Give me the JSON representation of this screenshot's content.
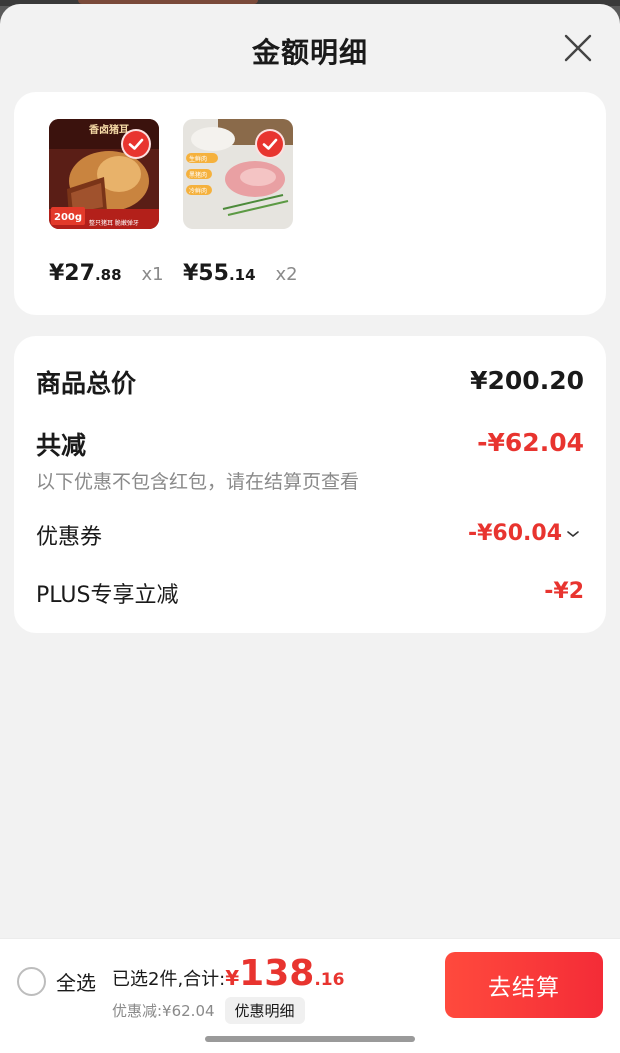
{
  "sheet": {
    "title": "金额明细",
    "close_icon": "close-icon"
  },
  "products": [
    {
      "name": "spiced-pig-ear",
      "image_texts": {
        "top": "香卤猪耳",
        "badge": "200g",
        "tags": "整只猪耳 脆嫩弹牙"
      },
      "price_main": "¥27",
      "price_dec": ".88",
      "qty": "x1",
      "selected": true
    },
    {
      "name": "raw-pork-cut",
      "image_texts": {
        "tag1": "生鲜肉",
        "tag2": "黑猪肉",
        "tag3": "冷鲜肉"
      },
      "price_main": "¥55",
      "price_dec": ".14",
      "qty": "x2",
      "selected": true
    }
  ],
  "summary": {
    "total_label": "商品总价",
    "total_value": "¥200.20",
    "reduce_label": "共减",
    "reduce_value": "-¥62.04",
    "note": "以下优惠不包含红包，请在结算页查看",
    "coupon_label": "优惠券",
    "coupon_value": "-¥60.04",
    "plus_label": "PLUS专享立减",
    "plus_value": "-¥2"
  },
  "bottom": {
    "select_all_label": "全选",
    "selected_text": "已选2件,合计:",
    "yen": "¥",
    "amount_main": "138",
    "amount_dec": ".16",
    "discount_text": "优惠减:¥62.04",
    "detail_tag": "优惠明细",
    "checkout_label": "去结算"
  },
  "colors": {
    "accent": "#e8342f",
    "sheet_bg": "#f2f2f2",
    "card_bg": "#ffffff"
  }
}
